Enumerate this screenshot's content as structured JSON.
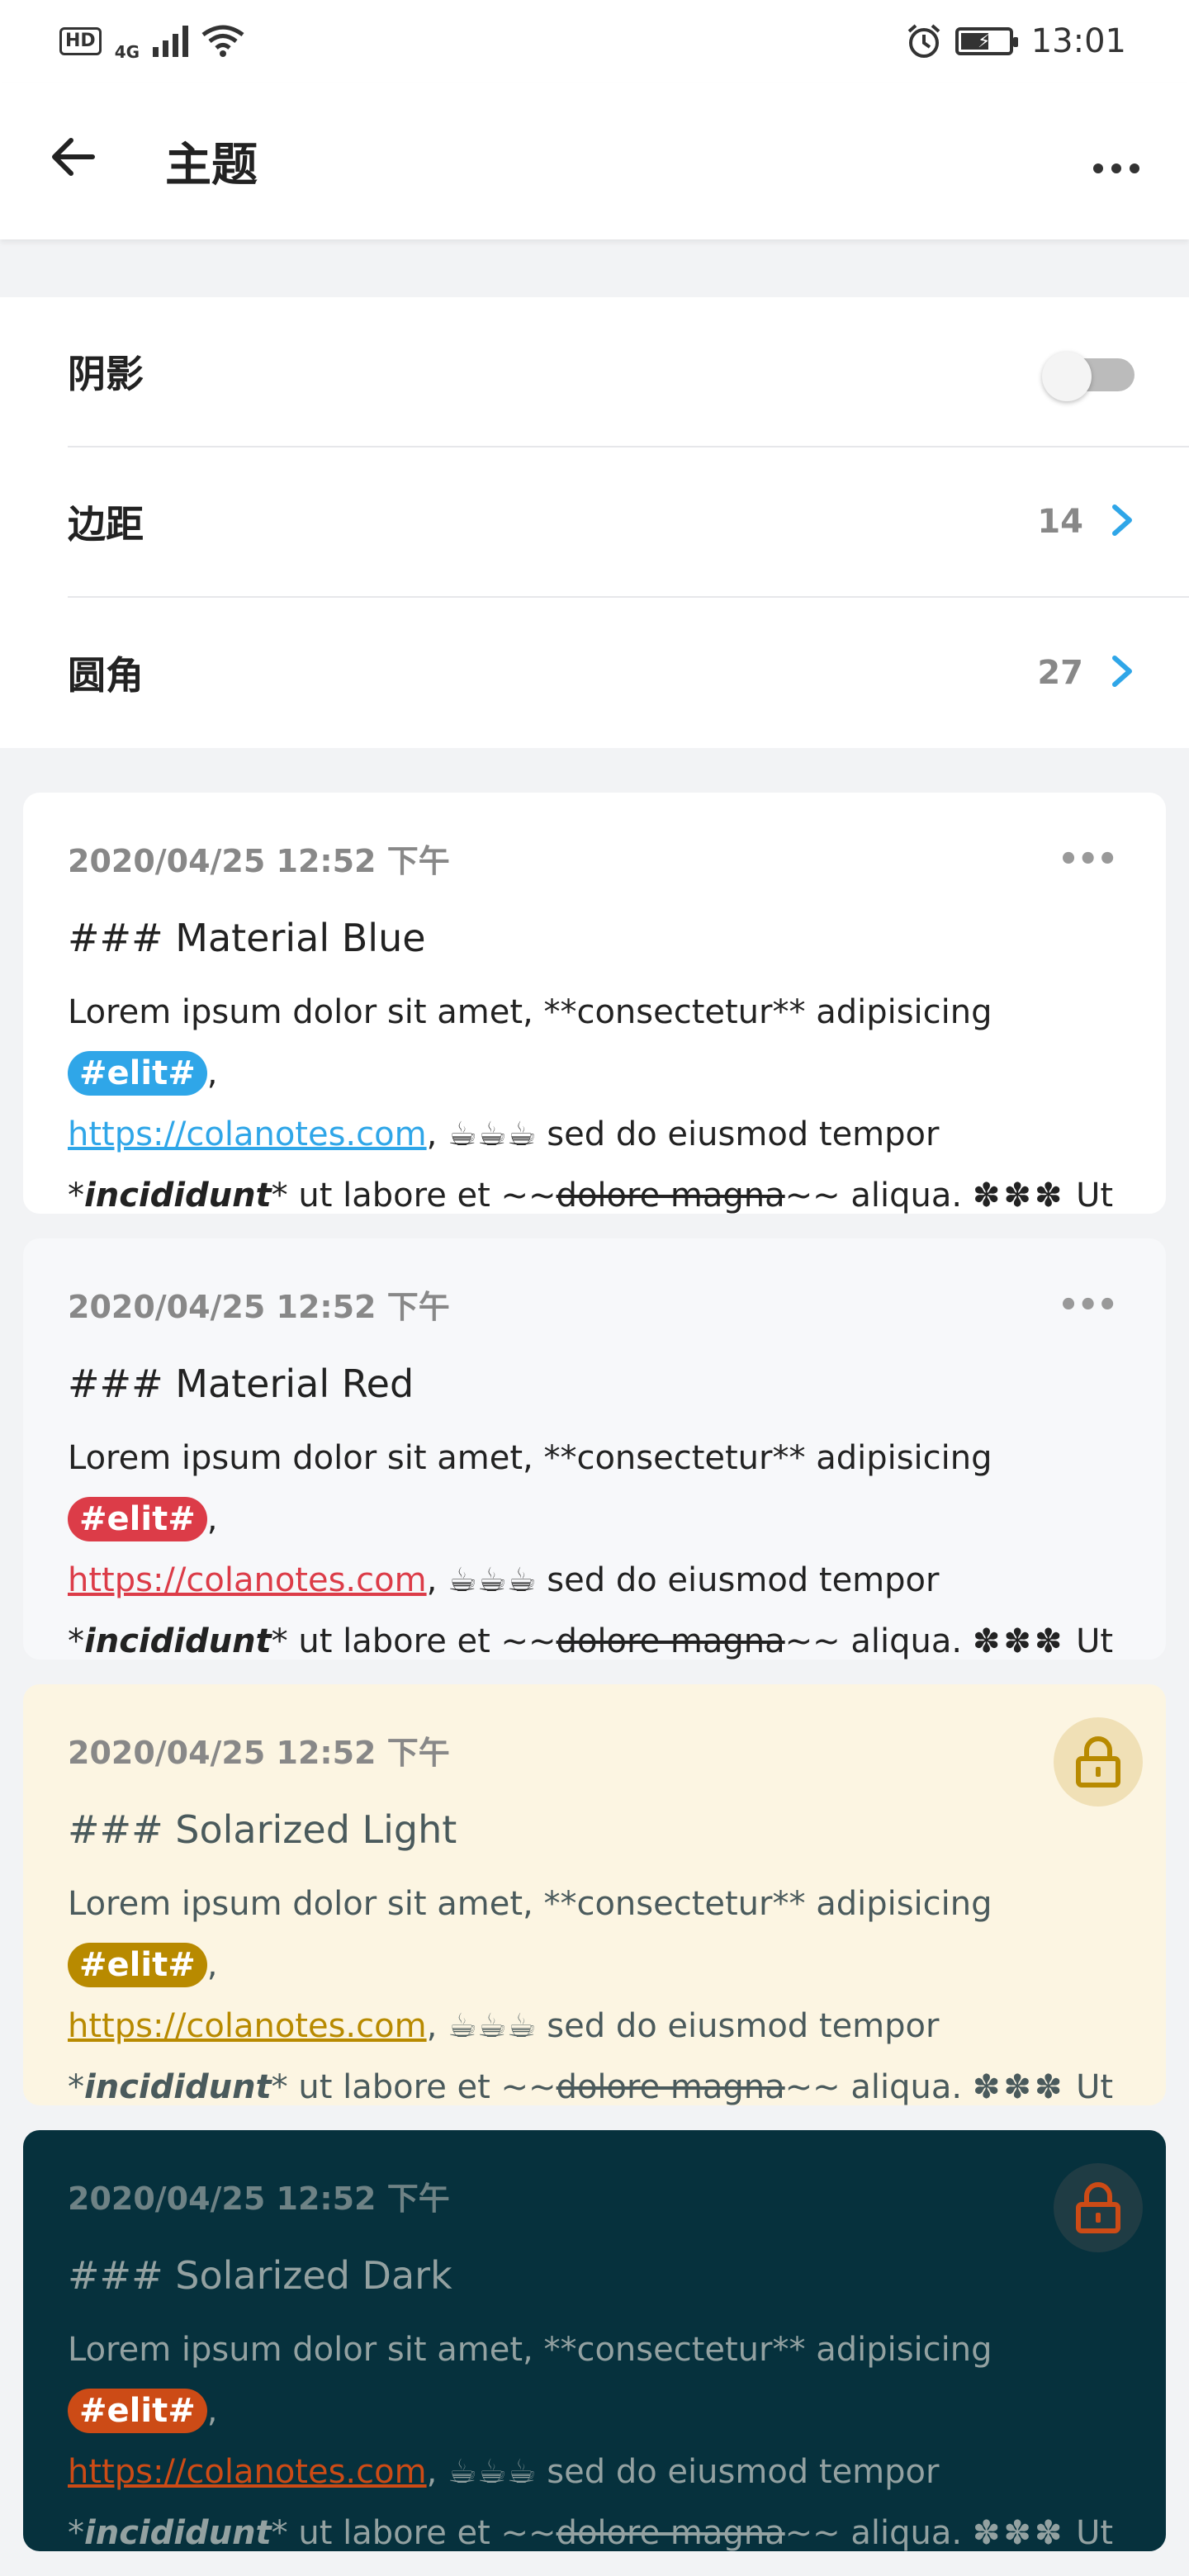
{
  "status_bar": {
    "hd": "HD",
    "network": "4G",
    "time": "13:01"
  },
  "app_bar": {
    "title": "主题"
  },
  "settings": {
    "shadow": {
      "label": "阴影",
      "enabled": false
    },
    "margin": {
      "label": "边距",
      "value": "14"
    },
    "radius": {
      "label": "圆角",
      "value": "27"
    }
  },
  "themes": [
    {
      "name": "Material Blue",
      "date": "2020/04/25 12:52 下午",
      "heading": "### Material Blue",
      "line1": "Lorem ipsum dolor sit amet, **consectetur** adipisicing ",
      "tag": "#elit#",
      "comma": ",",
      "link": "https://colanotes.com",
      "after_link": ", ☕☕☕ sed do eiusmod tempor",
      "star_open": "*",
      "emph": "incididunt",
      "after_emph": "* ut labore et ~~",
      "strike": "dolore magna",
      "after_strike": "~~ aliqua. ",
      "flowers": "✽✽✽",
      "end": " Ut",
      "colors": {
        "bg": "#ffffff",
        "text": "#222222",
        "accent": "#2fa6e8"
      },
      "action_icon": "more-dots-icon"
    },
    {
      "name": "Material Red",
      "date": "2020/04/25 12:52 下午",
      "heading": "### Material Red",
      "line1": "Lorem ipsum dolor sit amet, **consectetur** adipisicing ",
      "tag": "#elit#",
      "comma": ",",
      "link": "https://colanotes.com",
      "after_link": ", ☕☕☕ sed do eiusmod tempor",
      "star_open": "*",
      "emph": "incididunt",
      "after_emph": "* ut labore et ~~",
      "strike": "dolore magna",
      "after_strike": "~~ aliqua. ",
      "flowers": "✽✽✽",
      "end": " Ut",
      "colors": {
        "bg": "#f7f8fa",
        "text": "#222222",
        "accent": "#dc3c48"
      },
      "action_icon": "more-dots-icon"
    },
    {
      "name": "Solarized Light",
      "date": "2020/04/25 12:52 下午",
      "heading": "### Solarized Light",
      "line1": "Lorem ipsum dolor sit amet, **consectetur** adipisicing ",
      "tag": "#elit#",
      "comma": ",",
      "link": "https://colanotes.com",
      "after_link": ", ☕☕☕ sed do eiusmod tempor",
      "star_open": "*",
      "emph": "incididunt",
      "after_emph": "* ut labore et ~~",
      "strike": "dolore magna",
      "after_strike": "~~ aliqua. ",
      "flowers": "✽✽✽",
      "end": " Ut",
      "colors": {
        "bg": "#fcf5e2",
        "text": "#4a5a5c",
        "accent": "#b88a00",
        "icon_bg": "#f0e0b6"
      },
      "action_icon": "lock-icon"
    },
    {
      "name": "Solarized Dark",
      "date": "2020/04/25 12:52 下午",
      "heading": "### Solarized Dark",
      "line1": "Lorem ipsum dolor sit amet, **consectetur** adipisicing ",
      "tag": "#elit#",
      "comma": ",",
      "link": "https://colanotes.com",
      "after_link": ", ☕☕☕ sed do eiusmod tempor",
      "star_open": "*",
      "emph": "incididunt",
      "after_emph": "* ut labore et ~~",
      "strike": "dolore magna",
      "after_strike": "~~ aliqua. ",
      "flowers": "✽✽✽",
      "end": " Ut",
      "colors": {
        "bg": "#06313d",
        "text": "#93a1a1",
        "date": "#6e8285",
        "accent": "#cc4b16",
        "icon_bg": "#1f3c44"
      },
      "action_icon": "lock-icon"
    }
  ]
}
